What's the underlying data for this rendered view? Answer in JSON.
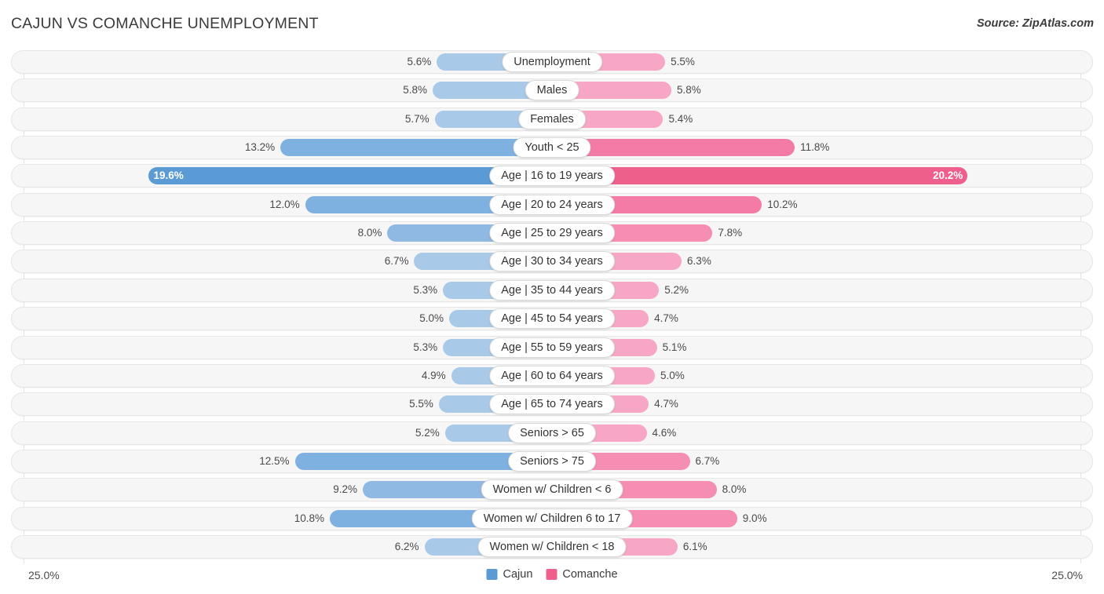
{
  "header": {
    "title": "CAJUN VS COMANCHE UNEMPLOYMENT",
    "source": "Source: ZipAtlas.com"
  },
  "footer": {
    "axis_min_label": "25.0%",
    "axis_max_label": "25.0%",
    "legend": [
      {
        "label": "Cajun",
        "color": "#5b9bd5"
      },
      {
        "label": "Comanche",
        "color": "#ef5f8c"
      }
    ]
  },
  "colors": {
    "left_light": "#a9c9e9",
    "left_mid": "#8fb9e3",
    "left_strong": "#7eb0e0",
    "left_highlight": "#5b9bd5",
    "right_light": "#f8a6c5",
    "right_mid": "#f68db3",
    "right_strong": "#f47ba6",
    "right_highlight": "#ef5f8c",
    "track_bg": "#f6f6f6",
    "gridline": "#e3e3e3"
  },
  "chart_data": {
    "type": "bar",
    "title": "CAJUN VS COMANCHE UNEMPLOYMENT",
    "subtitle": "Source: ZipAtlas.com",
    "orientation": "horizontal-diverging",
    "xlabel": "",
    "ylabel": "",
    "xlim": [
      -25.0,
      25.0
    ],
    "axis_max": 25.0,
    "grid": true,
    "legend_position": "bottom-center",
    "categories": [
      "Unemployment",
      "Males",
      "Females",
      "Youth < 25",
      "Age | 16 to 19 years",
      "Age | 20 to 24 years",
      "Age | 25 to 29 years",
      "Age | 30 to 34 years",
      "Age | 35 to 44 years",
      "Age | 45 to 54 years",
      "Age | 55 to 59 years",
      "Age | 60 to 64 years",
      "Age | 65 to 74 years",
      "Seniors > 65",
      "Seniors > 75",
      "Women w/ Children < 6",
      "Women w/ Children 6 to 17",
      "Women w/ Children < 18"
    ],
    "series": [
      {
        "name": "Cajun",
        "color": "#5b9bd5",
        "values": [
          5.6,
          5.8,
          5.7,
          13.2,
          19.6,
          12.0,
          8.0,
          6.7,
          5.3,
          5.0,
          5.3,
          4.9,
          5.5,
          5.2,
          12.5,
          9.2,
          10.8,
          6.2
        ]
      },
      {
        "name": "Comanche",
        "color": "#ef5f8c",
        "values": [
          5.5,
          5.8,
          5.4,
          11.8,
          20.2,
          10.2,
          7.8,
          6.3,
          5.2,
          4.7,
          5.1,
          5.0,
          4.7,
          4.6,
          6.7,
          8.0,
          9.0,
          6.1
        ]
      }
    ],
    "highlighted_category": "Age | 16 to 19 years"
  },
  "rows": [
    {
      "label": "Unemployment",
      "left": "5.6%",
      "right": "5.5%",
      "left_v": 5.6,
      "right_v": 5.5,
      "left_color": "#a9c9e9",
      "right_color": "#f8a6c5",
      "highlight": false
    },
    {
      "label": "Males",
      "left": "5.8%",
      "right": "5.8%",
      "left_v": 5.8,
      "right_v": 5.8,
      "left_color": "#a9c9e9",
      "right_color": "#f8a6c5",
      "highlight": false
    },
    {
      "label": "Females",
      "left": "5.7%",
      "right": "5.4%",
      "left_v": 5.7,
      "right_v": 5.4,
      "left_color": "#a9c9e9",
      "right_color": "#f8a6c5",
      "highlight": false
    },
    {
      "label": "Youth < 25",
      "left": "13.2%",
      "right": "11.8%",
      "left_v": 13.2,
      "right_v": 11.8,
      "left_color": "#7eb0e0",
      "right_color": "#f47ba6",
      "highlight": false
    },
    {
      "label": "Age | 16 to 19 years",
      "left": "19.6%",
      "right": "20.2%",
      "left_v": 19.6,
      "right_v": 20.2,
      "left_color": "#5b9bd5",
      "right_color": "#ef5f8c",
      "highlight": true
    },
    {
      "label": "Age | 20 to 24 years",
      "left": "12.0%",
      "right": "10.2%",
      "left_v": 12.0,
      "right_v": 10.2,
      "left_color": "#7eb0e0",
      "right_color": "#f47ba6",
      "highlight": false
    },
    {
      "label": "Age | 25 to 29 years",
      "left": "8.0%",
      "right": "7.8%",
      "left_v": 8.0,
      "right_v": 7.8,
      "left_color": "#8fb9e3",
      "right_color": "#f68db3",
      "highlight": false
    },
    {
      "label": "Age | 30 to 34 years",
      "left": "6.7%",
      "right": "6.3%",
      "left_v": 6.7,
      "right_v": 6.3,
      "left_color": "#a9c9e9",
      "right_color": "#f8a6c5",
      "highlight": false
    },
    {
      "label": "Age | 35 to 44 years",
      "left": "5.3%",
      "right": "5.2%",
      "left_v": 5.3,
      "right_v": 5.2,
      "left_color": "#a9c9e9",
      "right_color": "#f8a6c5",
      "highlight": false
    },
    {
      "label": "Age | 45 to 54 years",
      "left": "5.0%",
      "right": "4.7%",
      "left_v": 5.0,
      "right_v": 4.7,
      "left_color": "#a9c9e9",
      "right_color": "#f8a6c5",
      "highlight": false
    },
    {
      "label": "Age | 55 to 59 years",
      "left": "5.3%",
      "right": "5.1%",
      "left_v": 5.3,
      "right_v": 5.1,
      "left_color": "#a9c9e9",
      "right_color": "#f8a6c5",
      "highlight": false
    },
    {
      "label": "Age | 60 to 64 years",
      "left": "4.9%",
      "right": "5.0%",
      "left_v": 4.9,
      "right_v": 5.0,
      "left_color": "#a9c9e9",
      "right_color": "#f8a6c5",
      "highlight": false
    },
    {
      "label": "Age | 65 to 74 years",
      "left": "5.5%",
      "right": "4.7%",
      "left_v": 5.5,
      "right_v": 4.7,
      "left_color": "#a9c9e9",
      "right_color": "#f8a6c5",
      "highlight": false
    },
    {
      "label": "Seniors > 65",
      "left": "5.2%",
      "right": "4.6%",
      "left_v": 5.2,
      "right_v": 4.6,
      "left_color": "#a9c9e9",
      "right_color": "#f8a6c5",
      "highlight": false
    },
    {
      "label": "Seniors > 75",
      "left": "12.5%",
      "right": "6.7%",
      "left_v": 12.5,
      "right_v": 6.7,
      "left_color": "#7eb0e0",
      "right_color": "#f68db3",
      "highlight": false
    },
    {
      "label": "Women w/ Children < 6",
      "left": "9.2%",
      "right": "8.0%",
      "left_v": 9.2,
      "right_v": 8.0,
      "left_color": "#8fb9e3",
      "right_color": "#f68db3",
      "highlight": false
    },
    {
      "label": "Women w/ Children 6 to 17",
      "left": "10.8%",
      "right": "9.0%",
      "left_v": 10.8,
      "right_v": 9.0,
      "left_color": "#7eb0e0",
      "right_color": "#f68db3",
      "highlight": false
    },
    {
      "label": "Women w/ Children < 18",
      "left": "6.2%",
      "right": "6.1%",
      "left_v": 6.2,
      "right_v": 6.1,
      "left_color": "#a9c9e9",
      "right_color": "#f8a6c5",
      "highlight": false
    }
  ]
}
